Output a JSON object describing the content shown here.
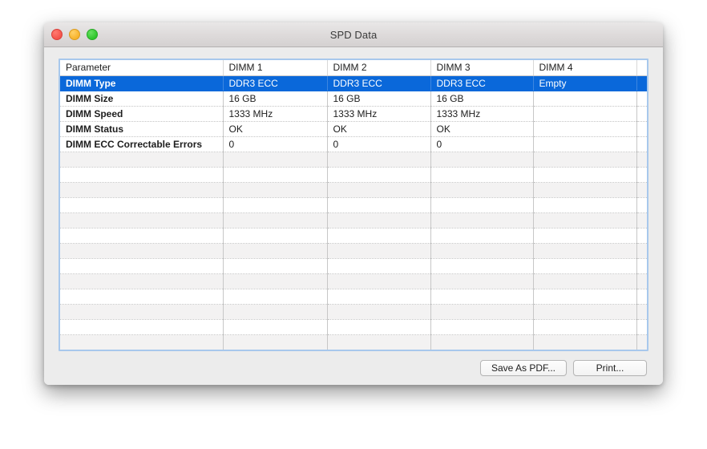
{
  "window": {
    "title": "SPD Data",
    "controls": [
      {
        "name": "close",
        "color": "#f4524a"
      },
      {
        "name": "minimize",
        "color": "#f7b32b"
      },
      {
        "name": "zoom",
        "color": "#2ec62b"
      }
    ]
  },
  "table": {
    "columns": [
      "Parameter",
      "DIMM 1",
      "DIMM 2",
      "DIMM 3",
      "DIMM 4",
      ""
    ],
    "rows": [
      {
        "selected": true,
        "cells": [
          "DIMM Type",
          "DDR3 ECC",
          "DDR3 ECC",
          "DDR3 ECC",
          "Empty",
          ""
        ]
      },
      {
        "selected": false,
        "cells": [
          "DIMM Size",
          "16 GB",
          "16 GB",
          "16 GB",
          "",
          ""
        ]
      },
      {
        "selected": false,
        "cells": [
          "DIMM Speed",
          "1333 MHz",
          "1333 MHz",
          "1333 MHz",
          "",
          ""
        ]
      },
      {
        "selected": false,
        "cells": [
          "DIMM Status",
          "OK",
          "OK",
          "OK",
          "",
          ""
        ]
      },
      {
        "selected": false,
        "cells": [
          "DIMM ECC Correctable Errors",
          "0",
          "0",
          "0",
          "",
          ""
        ]
      }
    ],
    "empty_row_count": 14,
    "selection_color": "#0a68da",
    "focus_ring_color": "#a8c8ec"
  },
  "footer": {
    "save_as_pdf_label": "Save As PDF...",
    "print_label": "Print..."
  }
}
